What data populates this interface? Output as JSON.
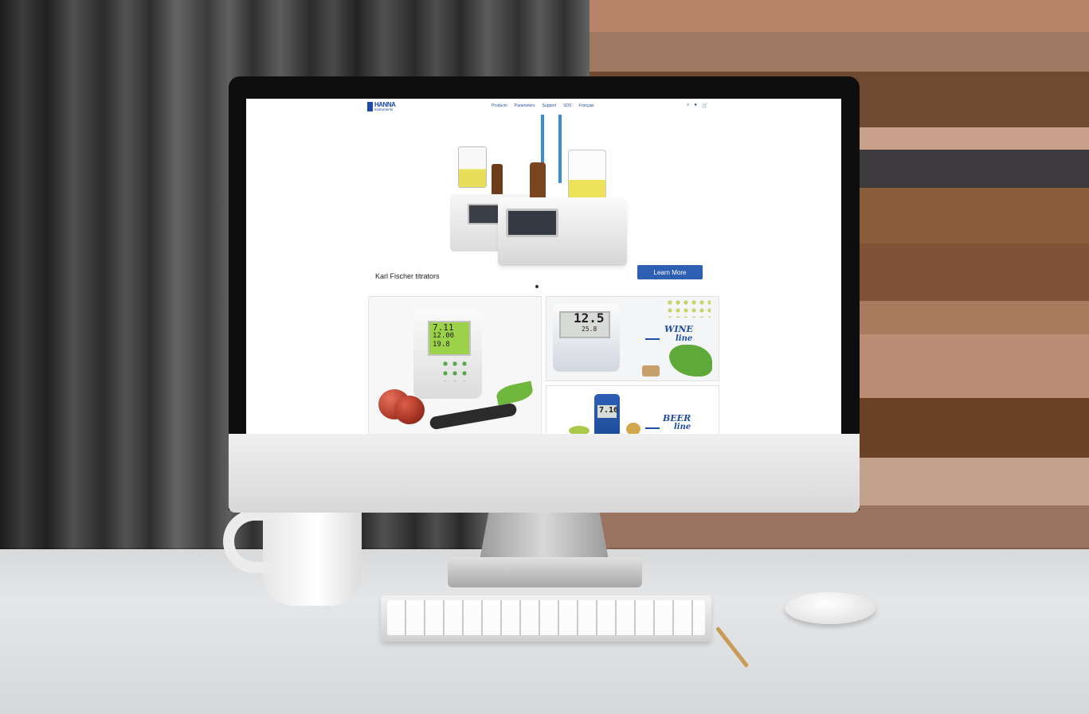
{
  "site": {
    "logo_word": "HANNA",
    "logo_sub": "instruments"
  },
  "nav": {
    "items": [
      "Products",
      "Parameters",
      "Support",
      "SDS",
      "Français"
    ]
  },
  "icons": [
    "search-icon",
    "user-icon",
    "cart-icon"
  ],
  "hero": {
    "title": "Karl Fischer titrators",
    "button_label": "Learn More"
  },
  "tiles": {
    "meter_readings": [
      "7.11",
      "12.00",
      "19.8"
    ],
    "wine_reading": "12.5",
    "wine_sub": "25.8",
    "wine_label_1": "WINE",
    "wine_label_2": "line",
    "beer_reading": "7.16",
    "beer_label_1": "BEER",
    "beer_label_2": "line"
  },
  "colors": {
    "brand_blue": "#1c4aa8",
    "button_blue": "#2d5fb3"
  }
}
